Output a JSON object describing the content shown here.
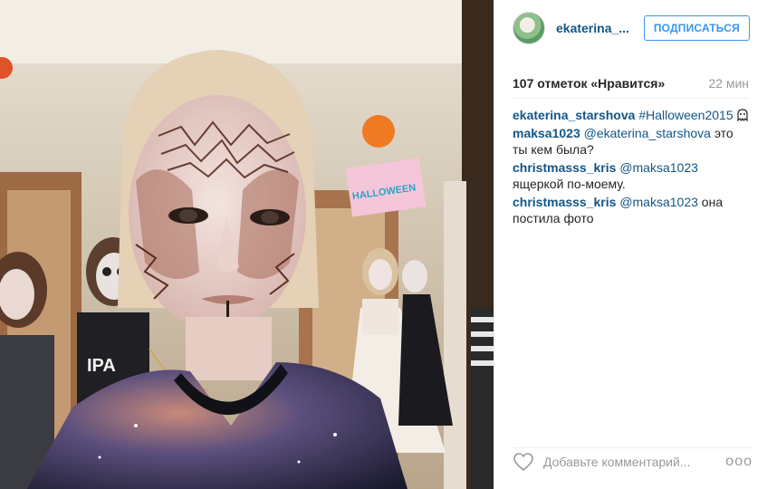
{
  "post": {
    "photo_description": "Selfie with Halloween face paint, party with people in skeleton makeup",
    "banner_text": "HALLOWEEN"
  },
  "header": {
    "username": "ekaterina_...",
    "follow_label": "ПОДПИСАТЬСЯ"
  },
  "stats": {
    "likes": "107 отметок «Нравится»",
    "time": "22 мин"
  },
  "comments": [
    {
      "user": "ekaterina_starshova",
      "mention": "",
      "text": "#Halloween2015"
    },
    {
      "user": "maksa1023",
      "mention": "@ekaterina_starshova",
      "text": " это ты кем была?"
    },
    {
      "user": "christmasss_kris",
      "mention": "@maksa1023",
      "text": " ящеркой по-моему."
    },
    {
      "user": "christmasss_kris",
      "mention": "@maksa1023",
      "text": " она постила фото"
    }
  ],
  "footer": {
    "comment_placeholder": "Добавьте комментарий...",
    "more_label": "ooo"
  },
  "colors": {
    "link": "#125688",
    "button": "#3897f0"
  }
}
